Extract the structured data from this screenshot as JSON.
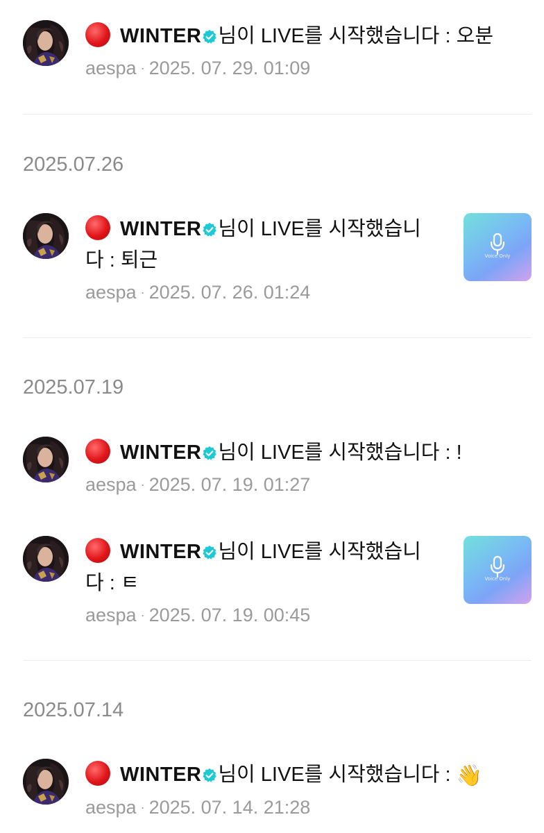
{
  "entries": [
    {
      "emoji": "red-circle",
      "name": "WINTER",
      "verified_icon": "verified-badge-icon",
      "message": "님이 LIVE를 시작했습니다 : 오분",
      "source": "aespa",
      "timestamp": "2025. 07. 29. 01:09",
      "has_thumbnail": false
    },
    {
      "emoji": "red-circle",
      "name": "WINTER",
      "verified_icon": "verified-badge-icon",
      "message_line1": "님이 LIVE를 시작했습니",
      "message_line2": "다 : 퇴근",
      "source": "aespa",
      "timestamp": "2025. 07. 26. 01:24",
      "has_thumbnail": true,
      "thumbnail_label": "Voice Only"
    },
    {
      "emoji": "red-circle",
      "name": "WINTER",
      "verified_icon": "verified-badge-icon",
      "message": "님이 LIVE를 시작했습니다 : !",
      "source": "aespa",
      "timestamp": "2025. 07. 19. 01:27",
      "has_thumbnail": false
    },
    {
      "emoji": "red-circle",
      "name": "WINTER",
      "verified_icon": "verified-badge-icon",
      "message_line1": "님이 LIVE를 시작했습니",
      "message_line2": "다 : ㅌ",
      "source": "aespa",
      "timestamp": "2025. 07. 19. 00:45",
      "has_thumbnail": true,
      "thumbnail_label": "Voice Only"
    },
    {
      "emoji": "red-circle",
      "name": "WINTER",
      "verified_icon": "verified-badge-icon",
      "message": "님이 LIVE를 시작했습니다 :",
      "message_emoji": "👋",
      "source": "aespa",
      "timestamp": "2025. 07. 14. 21:28",
      "has_thumbnail": false
    }
  ],
  "date_headers": [
    "2025.07.26",
    "2025.07.19",
    "2025.07.14"
  ],
  "separator": "·",
  "colors": {
    "text": "#111111",
    "meta": "#9a9a9a",
    "date_header": "#8a8a8a",
    "verified": "#1ec9d6",
    "live_dot": "#e0151a",
    "divider": "#ececec"
  }
}
